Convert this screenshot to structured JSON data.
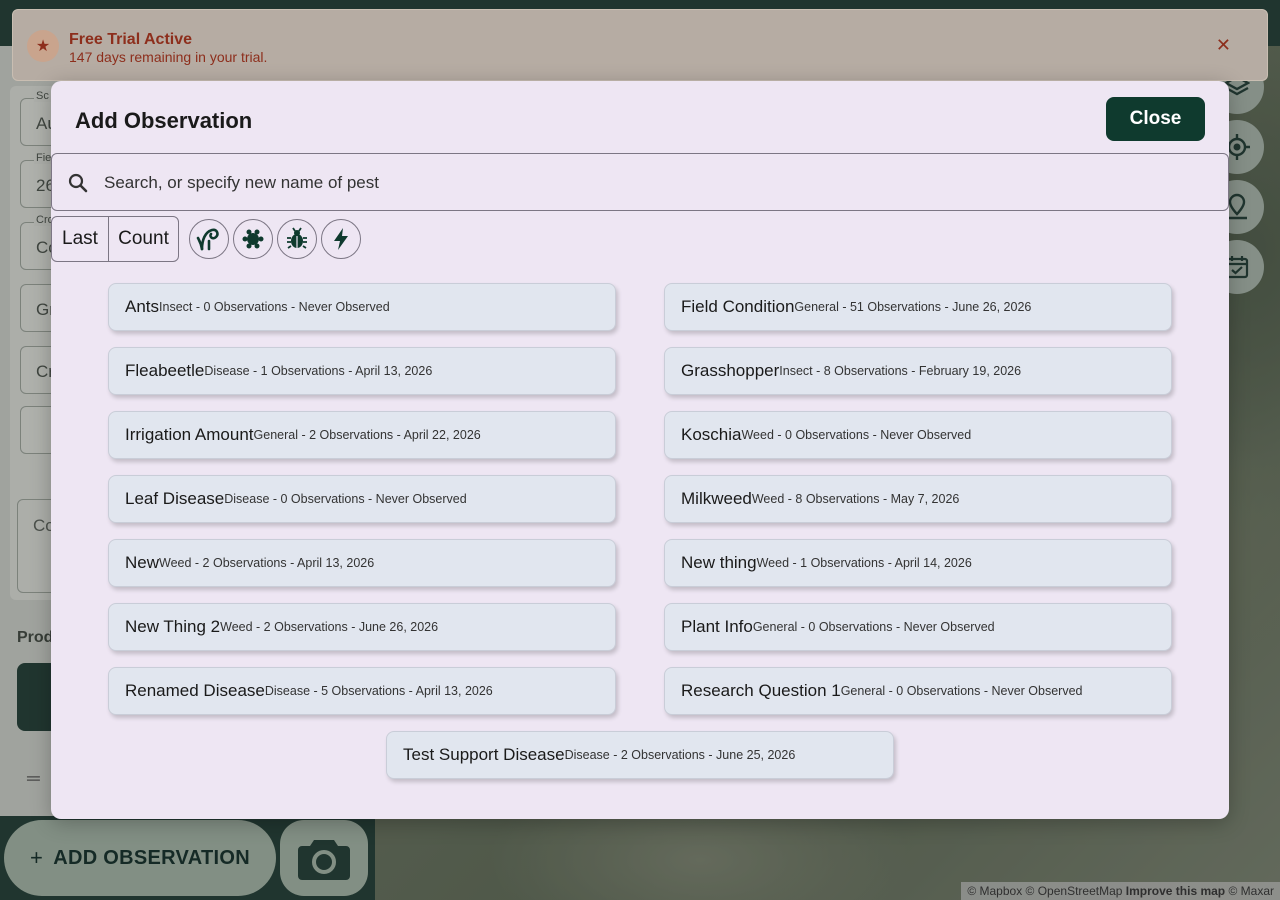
{
  "app": {
    "left_panel": {
      "fields": [
        {
          "label": "Sc",
          "value": "Au"
        },
        {
          "label": "Fie",
          "value": "26"
        },
        {
          "label": "Cro",
          "value": "Co"
        },
        {
          "label": "",
          "value": "Gr"
        },
        {
          "label": "",
          "value": "Cr"
        }
      ],
      "comment_placeholder": "Co",
      "products_label": "Prod",
      "handle_glyph": "═"
    },
    "bottom": {
      "add_observation_plus": "+",
      "add_observation_label": "ADD OBSERVATION"
    },
    "map_controls": [
      "layers-icon",
      "locate-icon",
      "pin-icon",
      "calendar-check-icon"
    ],
    "attribution": {
      "mapbox": "© Mapbox",
      "osm": "© OpenStreetMap",
      "improve": "Improve this map",
      "maxar": "© Maxar"
    }
  },
  "trial_banner": {
    "title": "Free Trial Active",
    "subtitle": "147 days remaining in your trial.",
    "close_glyph": "✕"
  },
  "modal": {
    "title": "Add Observation",
    "close_label": "Close",
    "search": {
      "placeholder": "Search, or specify new name of pest",
      "value": ""
    },
    "sort_buttons": [
      "Last",
      "Count"
    ],
    "filter_icons": [
      "disease-icon",
      "weed-icon",
      "insect-icon",
      "general-icon"
    ],
    "pests": [
      {
        "name": "Ants",
        "meta": "Insect - 0 Observations - Never Observed"
      },
      {
        "name": "Field Condition",
        "meta": "General - 51 Observations - June 26, 2026"
      },
      {
        "name": "Fleabeetle",
        "meta": "Disease - 1 Observations - April 13, 2026"
      },
      {
        "name": "Grasshopper",
        "meta": "Insect - 8 Observations - February 19, 2026"
      },
      {
        "name": "Irrigation Amount",
        "meta": "General - 2 Observations - April 22, 2026"
      },
      {
        "name": "Koschia",
        "meta": "Weed - 0 Observations - Never Observed"
      },
      {
        "name": "Leaf Disease",
        "meta": "Disease - 0 Observations - Never Observed"
      },
      {
        "name": "Milkweed",
        "meta": "Weed - 8 Observations - May 7, 2026"
      },
      {
        "name": "New",
        "meta": "Weed - 2 Observations - April 13, 2026"
      },
      {
        "name": "New thing",
        "meta": "Weed - 1 Observations - April 14, 2026"
      },
      {
        "name": "New Thing 2",
        "meta": "Weed - 2 Observations - June 26, 2026"
      },
      {
        "name": "Plant Info",
        "meta": "General - 0 Observations - Never Observed"
      },
      {
        "name": "Renamed Disease",
        "meta": "Disease - 5 Observations - April 13, 2026"
      },
      {
        "name": "Research Question 1",
        "meta": "General - 0 Observations - Never Observed"
      },
      {
        "name": "Test Support Disease",
        "meta": "Disease - 2 Observations - June 25, 2026"
      }
    ]
  }
}
